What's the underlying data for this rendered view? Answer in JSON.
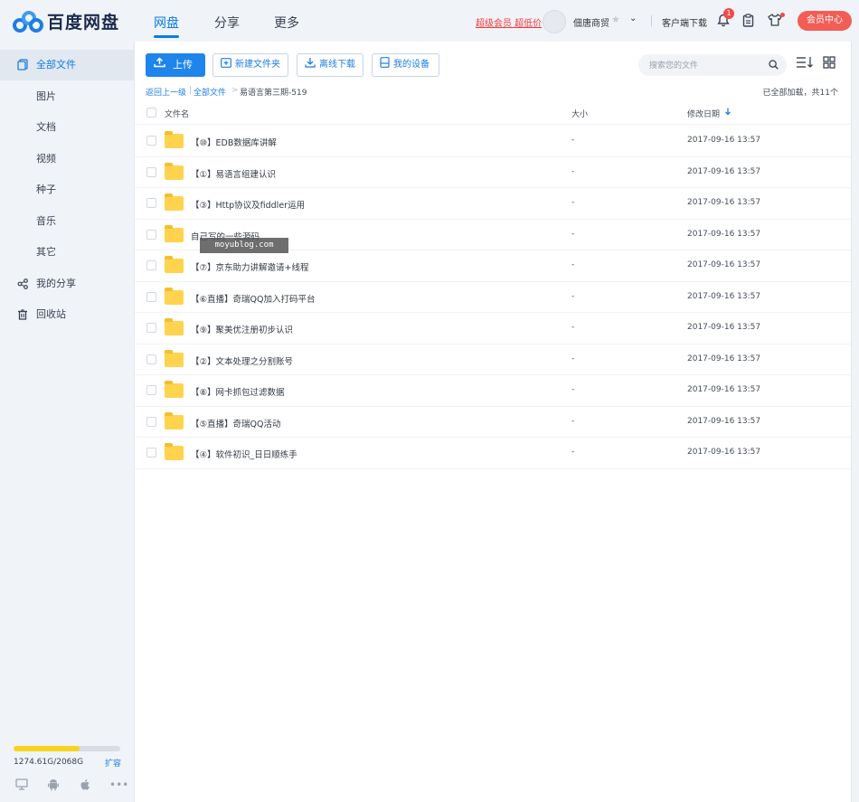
{
  "header": {
    "logo_text": "百度网盘",
    "tabs": [
      {
        "label": "网盘",
        "active": true
      },
      {
        "label": "分享",
        "active": false
      },
      {
        "label": "更多",
        "active": false
      }
    ],
    "promo": "超级会员 超低价",
    "username": "佃唐商贸",
    "client_download": "客户端下载",
    "notification_count": "1",
    "vip_center": "会员中心",
    "accent": "#1e7de4"
  },
  "sidebar": {
    "items": [
      {
        "label": "全部文件",
        "icon": "files-icon",
        "active": true
      },
      {
        "label": "图片"
      },
      {
        "label": "文档"
      },
      {
        "label": "视频"
      },
      {
        "label": "种子"
      },
      {
        "label": "音乐"
      },
      {
        "label": "其它"
      },
      {
        "label": "我的分享",
        "icon": "share-icon"
      },
      {
        "label": "回收站",
        "icon": "trash-icon"
      }
    ],
    "quota_text": "1274.61G/2068G",
    "quota_fraction": 0.616,
    "expand_label": "扩容"
  },
  "toolbar": {
    "upload": "上传",
    "new_folder": "新建文件夹",
    "offline_download": "离线下载",
    "my_devices": "我的设备",
    "search_placeholder": "搜索您的文件"
  },
  "breadcrumb": {
    "back": "返回上一级",
    "root": "全部文件",
    "current": "易语言第三期-519",
    "loaded": "已全部加载，共11个"
  },
  "table": {
    "columns": {
      "name": "文件名",
      "size": "大小",
      "date": "修改日期"
    },
    "rows": [
      {
        "name": "【⑩】EDB数据库讲解",
        "size": "-",
        "date": "2017-09-16 13:57"
      },
      {
        "name": "【①】易语言组建认识",
        "size": "-",
        "date": "2017-09-16 13:57"
      },
      {
        "name": "【③】Http协议及fiddler运用",
        "size": "-",
        "date": "2017-09-16 13:57"
      },
      {
        "name": "自己写的一些源码",
        "size": "-",
        "date": "2017-09-16 13:57"
      },
      {
        "name": "【⑦】京东助力讲解邀请+线程",
        "size": "-",
        "date": "2017-09-16 13:57"
      },
      {
        "name": "【⑥直播】奇瑞QQ加入打码平台",
        "size": "-",
        "date": "2017-09-16 13:57"
      },
      {
        "name": "【⑨】聚美优注册初步认识",
        "size": "-",
        "date": "2017-09-16 13:57"
      },
      {
        "name": "【②】文本处理之分割账号",
        "size": "-",
        "date": "2017-09-16 13:57"
      },
      {
        "name": "【⑧】网卡抓包过滤数据",
        "size": "-",
        "date": "2017-09-16 13:57"
      },
      {
        "name": "【⑤直播】奇瑞QQ活动",
        "size": "-",
        "date": "2017-09-16 13:57"
      },
      {
        "name": "【④】软件初识_日日顺练手",
        "size": "-",
        "date": "2017-09-16 13:57"
      }
    ]
  },
  "watermark": "moyublog.com"
}
